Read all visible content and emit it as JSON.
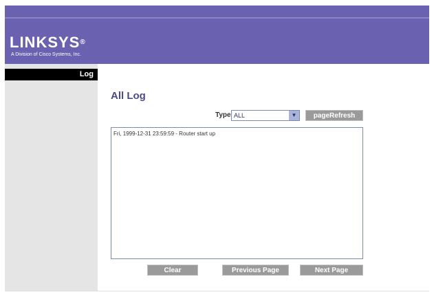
{
  "header": {
    "brand": "LINKSYS",
    "brand_mark": "®",
    "tagline": "A Division of Cisco Systems, Inc."
  },
  "sidebar": {
    "items": [
      {
        "label": "Log"
      }
    ]
  },
  "main": {
    "title": "All Log",
    "type_label": "Type:",
    "type_value": "ALL",
    "refresh_label": "pageRefresh",
    "log_text": "Fri, 1999-12-31 23:59:59 - Router start up",
    "clear_label": "Clear",
    "prev_label": "Previous Page",
    "next_label": "Next Page"
  },
  "colors": {
    "header": "#6a62b0",
    "sidebar": "#e5e5e5",
    "button": "#9a9a9a"
  }
}
